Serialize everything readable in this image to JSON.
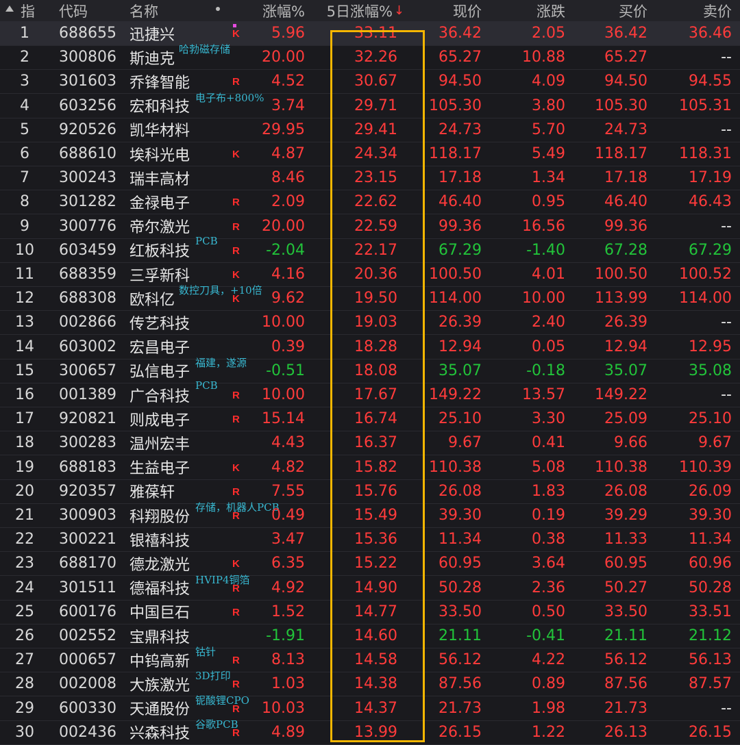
{
  "header": {
    "idx": "指",
    "code": "代码",
    "name": "名称",
    "pct": "涨幅%",
    "five_day": "5日涨幅%",
    "sort_indicator": "↓",
    "price": "现价",
    "change": "涨跌",
    "bid": "买价",
    "ask": "卖价"
  },
  "colors": {
    "up": "#ff3b3b",
    "down": "#22c33a",
    "highlight": "#f5b600",
    "tag": "#38b7d0"
  },
  "rows": [
    {
      "idx": "1",
      "code": "688655",
      "name": "迅捷兴",
      "tag": "",
      "mark": "K",
      "pct": "5.96",
      "five_day": "33.11",
      "price": "36.42",
      "change": "2.05",
      "bid": "36.42",
      "ask": "36.46",
      "dir": "up"
    },
    {
      "idx": "2",
      "code": "300806",
      "name": "斯迪克",
      "tag": "哈勃磁存储",
      "mark": "",
      "pct": "20.00",
      "five_day": "32.26",
      "price": "65.27",
      "change": "10.88",
      "bid": "65.27",
      "ask": "--",
      "dir": "up"
    },
    {
      "idx": "3",
      "code": "301603",
      "name": "乔锋智能",
      "tag": "",
      "mark": "R",
      "pct": "4.52",
      "five_day": "30.67",
      "price": "94.50",
      "change": "4.09",
      "bid": "94.50",
      "ask": "94.55",
      "dir": "up"
    },
    {
      "idx": "4",
      "code": "603256",
      "name": "宏和科技",
      "tag": "电子布+800%",
      "mark": "",
      "pct": "3.74",
      "five_day": "29.71",
      "price": "105.30",
      "change": "3.80",
      "bid": "105.30",
      "ask": "105.31",
      "dir": "up"
    },
    {
      "idx": "5",
      "code": "920526",
      "name": "凯华材料",
      "tag": "",
      "mark": "",
      "pct": "29.95",
      "five_day": "29.41",
      "price": "24.73",
      "change": "5.70",
      "bid": "24.73",
      "ask": "--",
      "dir": "up"
    },
    {
      "idx": "6",
      "code": "688610",
      "name": "埃科光电",
      "tag": "",
      "mark": "K",
      "pct": "4.87",
      "five_day": "24.34",
      "price": "118.17",
      "change": "5.49",
      "bid": "118.17",
      "ask": "118.31",
      "dir": "up"
    },
    {
      "idx": "7",
      "code": "300243",
      "name": "瑞丰高材",
      "tag": "",
      "mark": "",
      "pct": "8.46",
      "five_day": "23.15",
      "price": "17.18",
      "change": "1.34",
      "bid": "17.18",
      "ask": "17.19",
      "dir": "up"
    },
    {
      "idx": "8",
      "code": "301282",
      "name": "金禄电子",
      "tag": "",
      "mark": "R",
      "pct": "2.09",
      "five_day": "22.62",
      "price": "46.40",
      "change": "0.95",
      "bid": "46.40",
      "ask": "46.43",
      "dir": "up"
    },
    {
      "idx": "9",
      "code": "300776",
      "name": "帝尔激光",
      "tag": "",
      "mark": "R",
      "pct": "20.00",
      "five_day": "22.59",
      "price": "99.36",
      "change": "16.56",
      "bid": "99.36",
      "ask": "--",
      "dir": "up"
    },
    {
      "idx": "10",
      "code": "603459",
      "name": "红板科技",
      "tag": "PCB",
      "mark": "R",
      "pct": "-2.04",
      "five_day": "22.17",
      "price": "67.29",
      "change": "-1.40",
      "bid": "67.28",
      "ask": "67.29",
      "dir": "down"
    },
    {
      "idx": "11",
      "code": "688359",
      "name": "三孚新科",
      "tag": "",
      "mark": "K",
      "pct": "4.16",
      "five_day": "20.36",
      "price": "100.50",
      "change": "4.01",
      "bid": "100.50",
      "ask": "100.52",
      "dir": "up"
    },
    {
      "idx": "12",
      "code": "688308",
      "name": "欧科亿",
      "tag": "数控刀具，+10倍",
      "mark": "K",
      "pct": "9.62",
      "five_day": "19.50",
      "price": "114.00",
      "change": "10.00",
      "bid": "113.99",
      "ask": "114.00",
      "dir": "up"
    },
    {
      "idx": "13",
      "code": "002866",
      "name": "传艺科技",
      "tag": "",
      "mark": "",
      "pct": "10.00",
      "five_day": "19.03",
      "price": "26.39",
      "change": "2.40",
      "bid": "26.39",
      "ask": "--",
      "dir": "up"
    },
    {
      "idx": "14",
      "code": "603002",
      "name": "宏昌电子",
      "tag": "",
      "mark": "",
      "pct": "0.39",
      "five_day": "18.28",
      "price": "12.94",
      "change": "0.05",
      "bid": "12.94",
      "ask": "12.95",
      "dir": "up"
    },
    {
      "idx": "15",
      "code": "300657",
      "name": "弘信电子",
      "tag": "福建，遂源",
      "mark": "",
      "pct": "-0.51",
      "five_day": "18.08",
      "price": "35.07",
      "change": "-0.18",
      "bid": "35.07",
      "ask": "35.08",
      "dir": "down"
    },
    {
      "idx": "16",
      "code": "001389",
      "name": "广合科技",
      "tag": "PCB",
      "mark": "R",
      "pct": "10.00",
      "five_day": "17.67",
      "price": "149.22",
      "change": "13.57",
      "bid": "149.22",
      "ask": "--",
      "dir": "up"
    },
    {
      "idx": "17",
      "code": "920821",
      "name": "则成电子",
      "tag": "",
      "mark": "R",
      "pct": "15.14",
      "five_day": "16.74",
      "price": "25.10",
      "change": "3.30",
      "bid": "25.09",
      "ask": "25.10",
      "dir": "up"
    },
    {
      "idx": "18",
      "code": "300283",
      "name": "温州宏丰",
      "tag": "",
      "mark": "",
      "pct": "4.43",
      "five_day": "16.37",
      "price": "9.67",
      "change": "0.41",
      "bid": "9.66",
      "ask": "9.67",
      "dir": "up"
    },
    {
      "idx": "19",
      "code": "688183",
      "name": "生益电子",
      "tag": "",
      "mark": "K",
      "pct": "4.82",
      "five_day": "15.82",
      "price": "110.38",
      "change": "5.08",
      "bid": "110.38",
      "ask": "110.39",
      "dir": "up"
    },
    {
      "idx": "20",
      "code": "920357",
      "name": "雅葆轩",
      "tag": "",
      "mark": "R",
      "pct": "7.55",
      "five_day": "15.76",
      "price": "26.08",
      "change": "1.83",
      "bid": "26.08",
      "ask": "26.09",
      "dir": "up"
    },
    {
      "idx": "21",
      "code": "300903",
      "name": "科翔股份",
      "tag": "存储，机器人PCB",
      "mark": "R",
      "pct": "0.49",
      "five_day": "15.49",
      "price": "39.30",
      "change": "0.19",
      "bid": "39.29",
      "ask": "39.30",
      "dir": "up"
    },
    {
      "idx": "22",
      "code": "300221",
      "name": "银禧科技",
      "tag": "",
      "mark": "",
      "pct": "3.47",
      "five_day": "15.36",
      "price": "11.34",
      "change": "0.38",
      "bid": "11.33",
      "ask": "11.34",
      "dir": "up"
    },
    {
      "idx": "23",
      "code": "688170",
      "name": "德龙激光",
      "tag": "",
      "mark": "K",
      "pct": "6.35",
      "five_day": "15.22",
      "price": "60.95",
      "change": "3.64",
      "bid": "60.95",
      "ask": "60.96",
      "dir": "up"
    },
    {
      "idx": "24",
      "code": "301511",
      "name": "德福科技",
      "tag": "HVIP4铜箔",
      "mark": "R",
      "pct": "4.92",
      "five_day": "14.90",
      "price": "50.28",
      "change": "2.36",
      "bid": "50.27",
      "ask": "50.28",
      "dir": "up"
    },
    {
      "idx": "25",
      "code": "600176",
      "name": "中国巨石",
      "tag": "",
      "mark": "R",
      "pct": "1.52",
      "five_day": "14.77",
      "price": "33.50",
      "change": "0.50",
      "bid": "33.50",
      "ask": "33.51",
      "dir": "up"
    },
    {
      "idx": "26",
      "code": "002552",
      "name": "宝鼎科技",
      "tag": "",
      "mark": "",
      "pct": "-1.91",
      "five_day": "14.60",
      "price": "21.11",
      "change": "-0.41",
      "bid": "21.11",
      "ask": "21.12",
      "dir": "down"
    },
    {
      "idx": "27",
      "code": "000657",
      "name": "中钨高新",
      "tag": "钴针",
      "mark": "R",
      "pct": "8.13",
      "five_day": "14.58",
      "price": "56.12",
      "change": "4.22",
      "bid": "56.12",
      "ask": "56.13",
      "dir": "up"
    },
    {
      "idx": "28",
      "code": "002008",
      "name": "大族激光",
      "tag": "3D打印",
      "mark": "R",
      "pct": "1.03",
      "five_day": "14.38",
      "price": "87.56",
      "change": "0.89",
      "bid": "87.56",
      "ask": "87.57",
      "dir": "up"
    },
    {
      "idx": "29",
      "code": "600330",
      "name": "天通股份",
      "tag": "铌酸锂CPO",
      "mark": "R",
      "pct": "10.03",
      "five_day": "14.37",
      "price": "21.73",
      "change": "1.98",
      "bid": "21.73",
      "ask": "--",
      "dir": "up"
    },
    {
      "idx": "30",
      "code": "002436",
      "name": "兴森科技",
      "tag": "谷歌PCB",
      "mark": "R",
      "pct": "4.89",
      "five_day": "13.99",
      "price": "26.15",
      "change": "1.22",
      "bid": "26.13",
      "ask": "26.15",
      "dir": "up"
    }
  ]
}
